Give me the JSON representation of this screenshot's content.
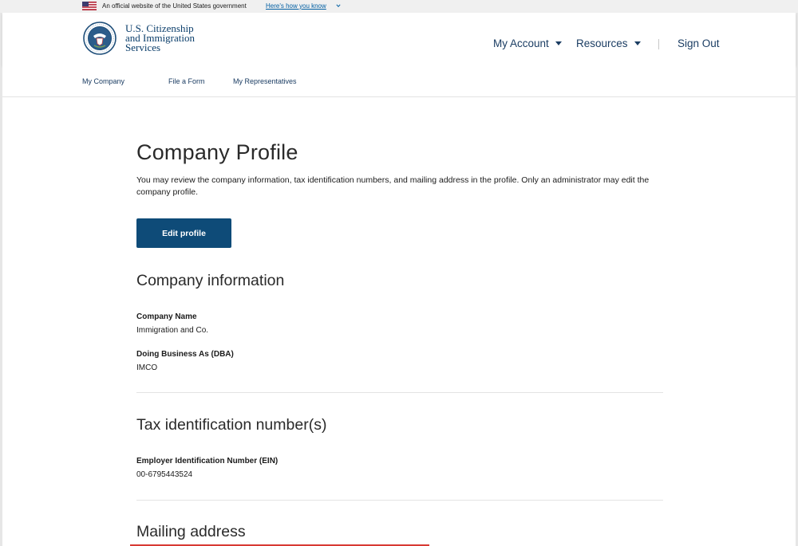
{
  "gov_banner": {
    "text": "An official website of the United States government",
    "link": "Here's how you know"
  },
  "header": {
    "agency_line1": "U.S. Citizenship",
    "agency_line2": "and Immigration",
    "agency_line3": "Services",
    "nav": {
      "my_account": "My Account",
      "resources": "Resources",
      "sign_out": "Sign Out"
    }
  },
  "subnav": {
    "items": [
      {
        "label": "My Company"
      },
      {
        "label": "File a Form"
      },
      {
        "label": "My Representatives"
      }
    ]
  },
  "main": {
    "title": "Company Profile",
    "intro": "You may review the company information, tax identification numbers, and mailing address in the profile. Only an administrator may edit the company profile.",
    "edit_button": "Edit profile",
    "company_info": {
      "heading": "Company information",
      "name_label": "Company Name",
      "name_value": "Immigration and Co.",
      "dba_label": "Doing Business As (DBA)",
      "dba_value": "IMCO"
    },
    "tax": {
      "heading": "Tax identification number(s)",
      "ein_label": "Employer Identification Number (EIN)",
      "ein_value": "00-6795443524"
    },
    "mailing": {
      "heading": "Mailing address"
    }
  },
  "colors": {
    "primary_button": "#0e4b78",
    "link": "#005ea2",
    "nav_text": "#1b3d63",
    "accent_red": "#d83933"
  },
  "icons": {
    "flag": "us-flag-icon",
    "seal": "dhs-seal-icon",
    "chevron": "chevron-down-icon"
  }
}
